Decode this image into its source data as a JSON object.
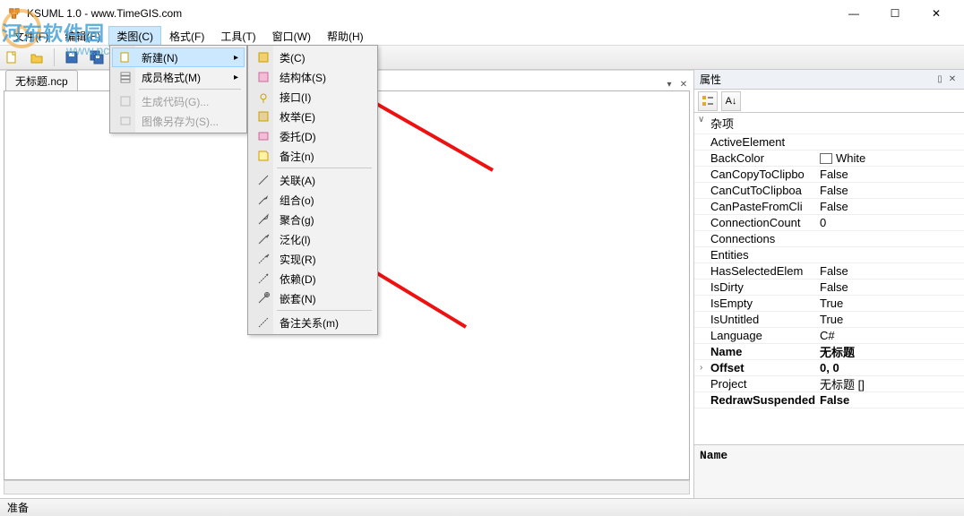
{
  "app": {
    "title": "KSUML 1.0 - www.TimeGIS.com"
  },
  "winbtns": {
    "min": "—",
    "max": "☐",
    "close": "✕"
  },
  "menubar": {
    "items": [
      "文件(F)",
      "编辑(E)",
      "类图(C)",
      "格式(F)",
      "工具(T)",
      "窗口(W)",
      "帮助(H)"
    ],
    "open_index": 2
  },
  "menu1": {
    "items": [
      {
        "label": "新建(N)",
        "icon": "new",
        "submenu": true,
        "highlight": true
      },
      {
        "label": "成员格式(M)",
        "icon": "members",
        "submenu": true
      },
      {
        "sep": true
      },
      {
        "label": "生成代码(G)...",
        "icon": "gen",
        "disabled": true
      },
      {
        "label": "图像另存为(S)...",
        "icon": "saveimg",
        "disabled": true
      }
    ]
  },
  "menu2": {
    "items": [
      {
        "label": "类(C)",
        "icon": "class"
      },
      {
        "label": "结构体(S)",
        "icon": "struct"
      },
      {
        "label": "接口(I)",
        "icon": "interface"
      },
      {
        "label": "枚举(E)",
        "icon": "enum"
      },
      {
        "label": "委托(D)",
        "icon": "delegate"
      },
      {
        "label": "备注(n)",
        "icon": "note"
      },
      {
        "sep": true
      },
      {
        "label": "关联(A)",
        "icon": "assoc"
      },
      {
        "label": "组合(o)",
        "icon": "compose"
      },
      {
        "label": "聚合(g)",
        "icon": "aggregate"
      },
      {
        "label": "泛化(l)",
        "icon": "general"
      },
      {
        "label": "实现(R)",
        "icon": "realize"
      },
      {
        "label": "依赖(D)",
        "icon": "depend"
      },
      {
        "label": "嵌套(N)",
        "icon": "nest"
      },
      {
        "sep": true
      },
      {
        "label": "备注关系(m)",
        "icon": "noterel"
      }
    ]
  },
  "toolbar": {
    "icons": [
      "new-doc-icon",
      "open-icon",
      "save-icon",
      "saveall-icon",
      "print-icon"
    ]
  },
  "tabs": {
    "items": [
      "无标题.ncp"
    ]
  },
  "properties": {
    "title": "属性",
    "cat": "杂项",
    "rows": [
      {
        "k": "ActiveElement",
        "v": ""
      },
      {
        "k": "BackColor",
        "v": "White",
        "color": true
      },
      {
        "k": "CanCopyToClipbo",
        "v": "False"
      },
      {
        "k": "CanCutToClipboa",
        "v": "False"
      },
      {
        "k": "CanPasteFromCli",
        "v": "False"
      },
      {
        "k": "ConnectionCount",
        "v": "0"
      },
      {
        "k": "Connections",
        "v": ""
      },
      {
        "k": "Entities",
        "v": ""
      },
      {
        "k": "HasSelectedElem",
        "v": "False"
      },
      {
        "k": "IsDirty",
        "v": "False"
      },
      {
        "k": "IsEmpty",
        "v": "True"
      },
      {
        "k": "IsUntitled",
        "v": "True"
      },
      {
        "k": "Language",
        "v": "C#"
      },
      {
        "k": "Name",
        "v": "无标题",
        "bold": true
      },
      {
        "k": "Offset",
        "v": "0, 0",
        "bold": true,
        "exp": true
      },
      {
        "k": "Project",
        "v": "无标题 []"
      },
      {
        "k": "RedrawSuspended",
        "v": "False",
        "bold": true
      }
    ],
    "desc_label": "Name"
  },
  "status": {
    "text": "准备"
  },
  "watermark": {
    "line1": "河东软件园"
  }
}
